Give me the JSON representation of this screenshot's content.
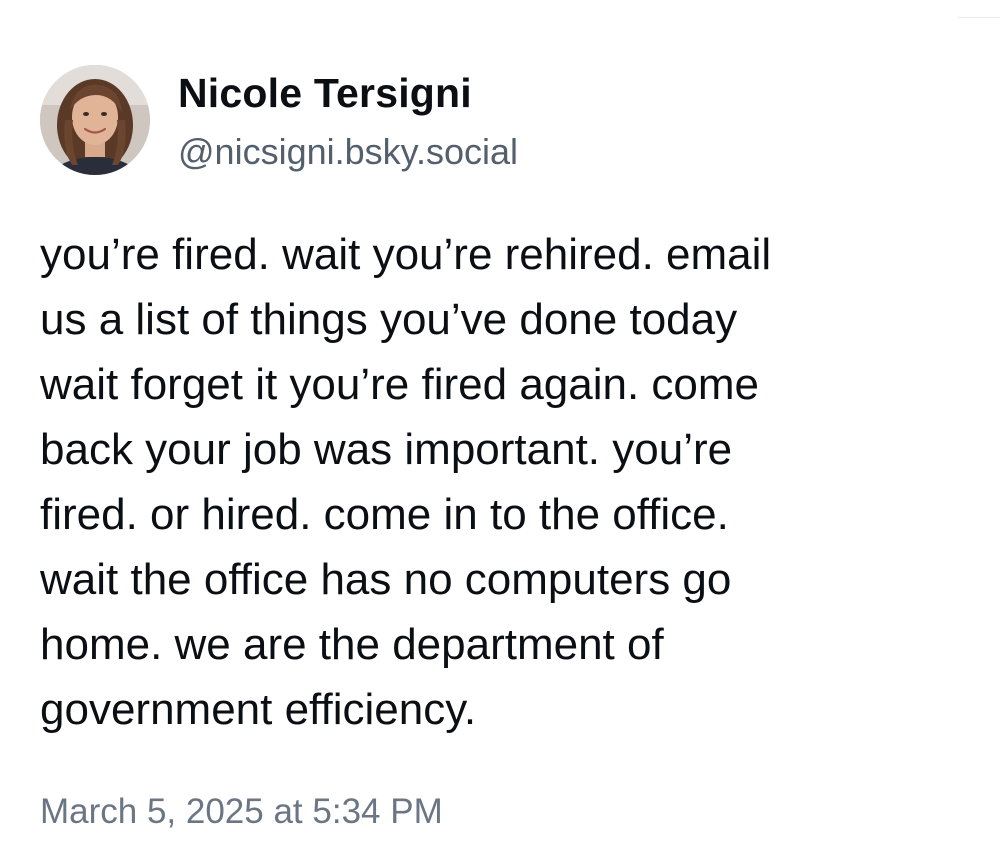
{
  "author": {
    "display_name": "Nicole Tersigni",
    "handle": "@nicsigni.bsky.social",
    "avatar_icon": "profile-photo"
  },
  "post": {
    "text": "you’re fired. wait you’re rehired. email\nus a list of things you’ve done today\nwait forget it you’re fired again. come\nback your job was important. you’re\nfired. or hired. come in to the office.\nwait the office has no computers go\nhome. we are the department of\ngovernment efficiency.",
    "timestamp": "March 5, 2025 at 5:34 PM"
  },
  "colors": {
    "text_primary": "#0b0f14",
    "text_secondary": "#545f6e",
    "timestamp": "#6b7685",
    "background": "#ffffff"
  }
}
